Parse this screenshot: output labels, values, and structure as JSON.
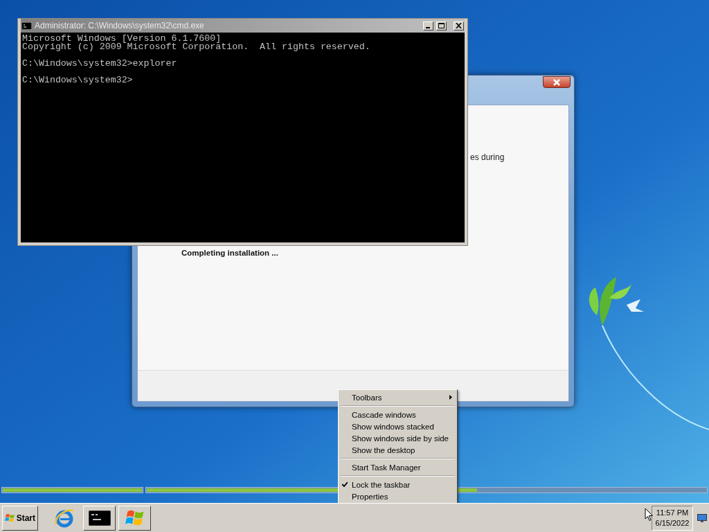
{
  "console_window": {
    "title": "Administrator: C:\\Windows\\system32\\cmd.exe",
    "blocks": [
      {
        "lines": [
          "Microsoft Windows [Version 6.1.7600]",
          "Copyright (c) 2009 Microsoft Corporation.  All rights reserved."
        ]
      },
      {
        "lines": [
          "C:\\Windows\\system32>explorer"
        ]
      },
      {
        "lines": [
          "C:\\Windows\\system32>"
        ]
      }
    ]
  },
  "setup_window": {
    "texts": [
      {
        "kind": "fragment",
        "text": "es during"
      },
      {
        "kind": "status",
        "text": "Completing installation ..."
      }
    ]
  },
  "progress": [
    {
      "level": 1
    },
    {
      "level": 0.59
    }
  ],
  "context_menu": {
    "items": [
      {
        "kind": "submenu",
        "label": "Toolbars",
        "checked": false
      },
      {
        "kind": "separator"
      },
      {
        "kind": "item",
        "label": "Cascade windows",
        "checked": false
      },
      {
        "kind": "item",
        "label": "Show windows stacked",
        "checked": false
      },
      {
        "kind": "item",
        "label": "Show windows side by side",
        "checked": false
      },
      {
        "kind": "item",
        "label": "Show the desktop",
        "checked": false
      },
      {
        "kind": "separator"
      },
      {
        "kind": "item",
        "label": "Start Task Manager",
        "checked": false
      },
      {
        "kind": "separator"
      },
      {
        "kind": "item",
        "label": "Lock the taskbar",
        "checked": true
      },
      {
        "kind": "item",
        "label": "Properties",
        "checked": false
      }
    ]
  },
  "taskbar": {
    "start": "Start",
    "buttons": [
      {
        "kind": "browser"
      },
      {
        "kind": "console"
      },
      {
        "kind": "windows"
      }
    ],
    "clock": {
      "time": "11:57 PM",
      "date": "6/15/2022"
    }
  }
}
